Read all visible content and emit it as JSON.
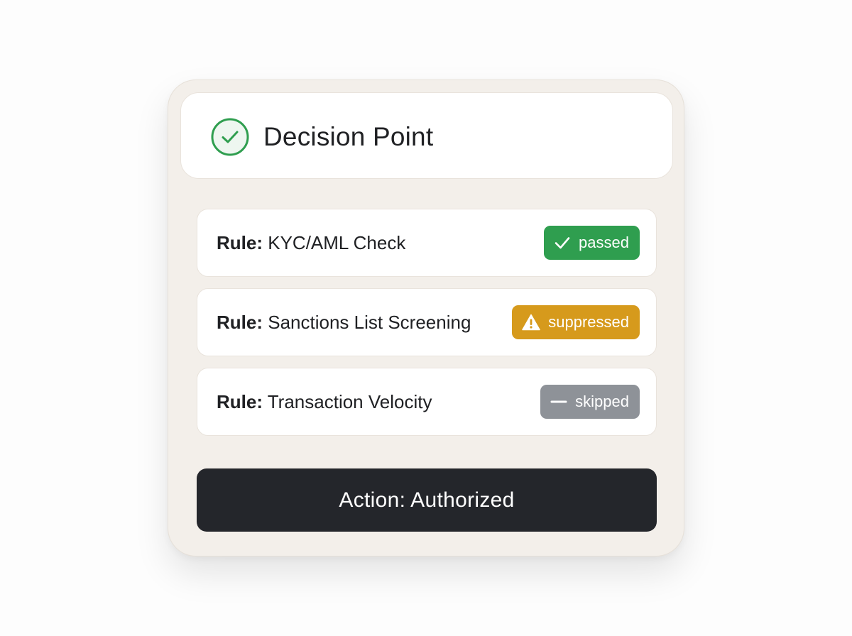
{
  "header": {
    "title": "Decision Point",
    "icon": "check-circle-icon",
    "icon_color": "#2f9e4f"
  },
  "rules": [
    {
      "prefix": "Rule:",
      "name": "KYC/AML Check",
      "status": "passed",
      "status_icon": "check-icon",
      "status_color": "#2f9e4f"
    },
    {
      "prefix": "Rule:",
      "name": "Sanctions List Screening",
      "status": "suppressed",
      "status_icon": "warning-icon",
      "status_color": "#d69a1c"
    },
    {
      "prefix": "Rule:",
      "name": "Transaction Velocity",
      "status": "skipped",
      "status_icon": "minus-icon",
      "status_color": "#8e9298"
    }
  ],
  "action": {
    "label": "Action: Authorized",
    "color": "#24262b"
  }
}
